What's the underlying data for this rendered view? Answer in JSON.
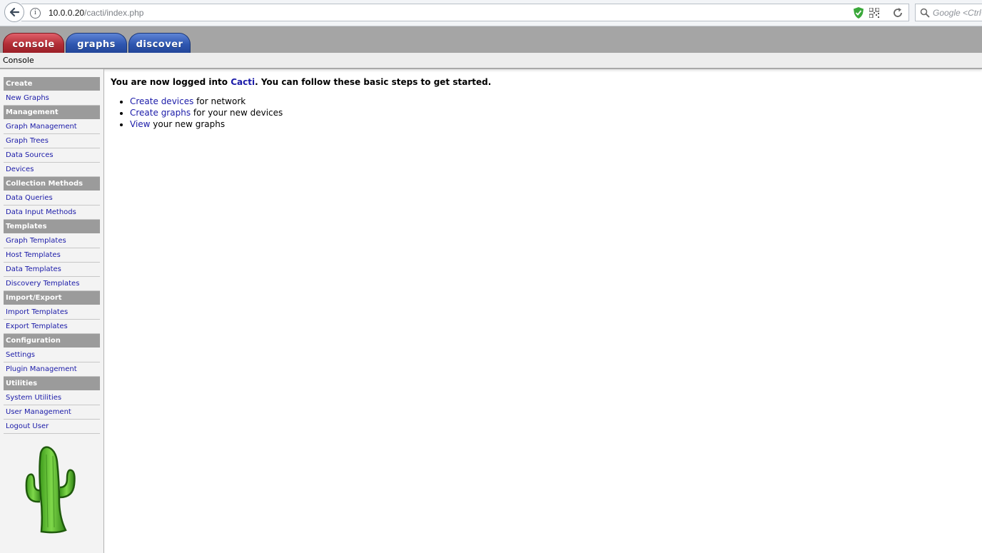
{
  "browser": {
    "url_host": "10.0.0.20",
    "url_path": "/cacti/index.php",
    "search_placeholder": "Google <Ctrl+K>"
  },
  "tabs": [
    {
      "label": "console",
      "active": true
    },
    {
      "label": "graphs",
      "active": false
    },
    {
      "label": "discover",
      "active": false
    }
  ],
  "breadcrumb": "Console",
  "sidebar": {
    "sections": [
      {
        "title": "Create",
        "items": [
          "New Graphs"
        ]
      },
      {
        "title": "Management",
        "items": [
          "Graph Management",
          "Graph Trees",
          "Data Sources",
          "Devices"
        ]
      },
      {
        "title": "Collection Methods",
        "items": [
          "Data Queries",
          "Data Input Methods"
        ]
      },
      {
        "title": "Templates",
        "items": [
          "Graph Templates",
          "Host Templates",
          "Data Templates",
          "Discovery Templates"
        ]
      },
      {
        "title": "Import/Export",
        "items": [
          "Import Templates",
          "Export Templates"
        ]
      },
      {
        "title": "Configuration",
        "items": [
          "Settings",
          "Plugin Management"
        ]
      },
      {
        "title": "Utilities",
        "items": [
          "System Utilities",
          "User Management",
          "Logout User"
        ]
      }
    ],
    "logo_icon": "cacti-cactus-logo"
  },
  "main": {
    "welcome_pre": "You are now logged into ",
    "welcome_link": "Cacti",
    "welcome_post": ". You can follow these basic steps to get started.",
    "steps": [
      {
        "link": "Create devices",
        "text": " for network"
      },
      {
        "link": "Create graphs",
        "text": " for your new devices"
      },
      {
        "link": "View",
        "text": " your new graphs"
      }
    ]
  },
  "colors": {
    "link": "#1a1aa8",
    "console_tab": "#b22e36",
    "graphs_tab": "#2f57b0",
    "menu_header": "#9b9b9b",
    "cactus_green": "#5fc12b"
  }
}
